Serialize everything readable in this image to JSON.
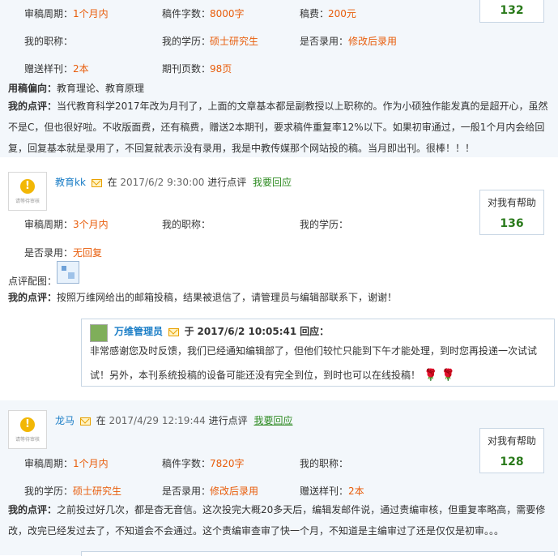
{
  "top": {
    "r1": {
      "period_label": "审稿周期：",
      "period": "1个月内",
      "words_label": "稿件字数：",
      "words": "8000字",
      "fee_label": "稿费：",
      "fee": "200元"
    },
    "r2": {
      "title_label": "我的职称：",
      "edu_label": "我的学历：",
      "edu": "硕士研究生",
      "accept_label": "是否录用：",
      "accept": "修改后录用"
    },
    "r3": {
      "samples_label": "赠送样刊：",
      "samples": "2本",
      "pages_label": "期刊页数：",
      "pages": "98页"
    },
    "helpful_count": "132",
    "preference_label": "用稿偏向：",
    "preference": "教育理论、教育原理",
    "comment_label": "我的点评：",
    "comment": "当代教育科学2017年改为月刊了，上面的文章基本都是副教授以上职称的。作为小硕独作能发真的是超开心，虽然不是C，但也很好啦。不收版面费，还有稿费，赠送2本期刊，要求稿件重复率12%以下。如果初审通过，一般1个月内会给回复，回复基本就是录用了，不回复就表示没有录用，我是中教传媒那个网站投的稿。当月即出刊。很棒！！！"
  },
  "review2": {
    "user": "教育kk",
    "meta_in": "在",
    "date": "2017/6/2 9:30:00",
    "meta_action": "进行点评",
    "reply_link": "我要回应",
    "avatar_text": "请等待审核",
    "help_label": "对我有帮助",
    "help_count": "136",
    "period_label": "审稿周期：",
    "period": "3个月内",
    "title_label": "我的职称：",
    "edu_label": "我的学历：",
    "accept_label": "是否录用：",
    "accept": "无回复",
    "image_label": "点评配图：",
    "comment_label": "我的点评：",
    "comment": "按照万维网给出的邮箱投稿，结果被退信了，请管理员与编辑部联系下，谢谢！",
    "reply": {
      "author": "万维管理员",
      "in": "于",
      "date": "2017/6/2 10:05:41",
      "action": "回应：",
      "text1": "非常感谢您及时反馈，我们已经通知编辑部了，但他们较忙只能到下午才能处理，到时您再投递一次试试",
      "text2": "试！另外，本刊系统投稿的设备可能还没有完全到位，到时也可以在线投稿！"
    }
  },
  "review3": {
    "user": "龙马",
    "meta_in": "在",
    "date": "2017/4/29 12:19:44",
    "meta_action": "进行点评",
    "reply_link": "我要回应",
    "avatar_text": "请等待审核",
    "help_label": "对我有帮助",
    "help_count": "128",
    "period_label": "审稿周期：",
    "period": "1个月内",
    "words_label": "稿件字数：",
    "words": "7820字",
    "title_label": "我的职称：",
    "edu_label": "我的学历：",
    "edu": "硕士研究生",
    "accept_label": "是否录用：",
    "accept": "修改后录用",
    "samples_label": "赠送样刊：",
    "samples": "2本",
    "comment_label": "我的点评：",
    "comment": "之前投过好几次，都是杳无音信。这次投完大概20多天后，编辑发邮件说，通过责编审核，但重复率略高，需要修改，改完已经发过去了，不知道会不会通过。这个责编审查审了快一个月，不知道是主编审过了还是仅仅是初审。。。"
  }
}
